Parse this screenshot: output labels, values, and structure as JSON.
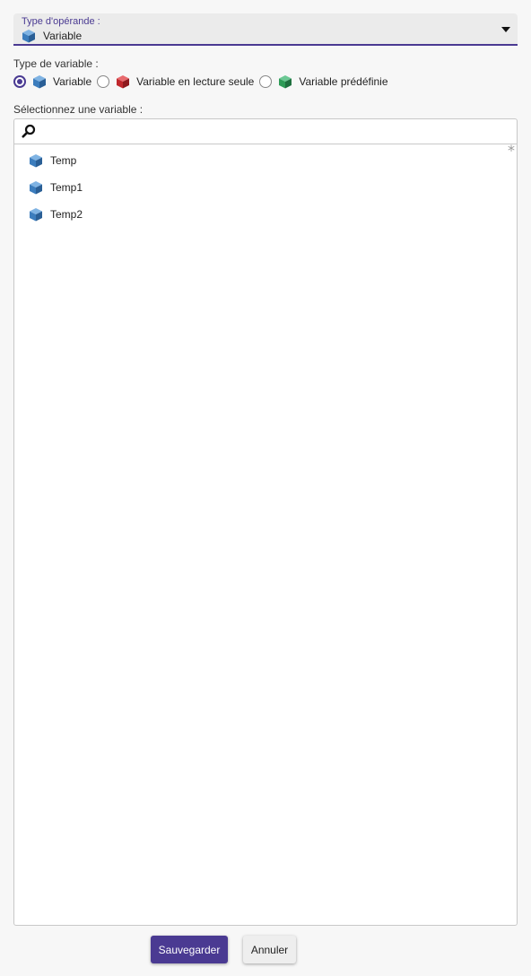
{
  "operand_select": {
    "label": "Type d'opérande :",
    "value": "Variable",
    "value_icon": "blue-cube-icon"
  },
  "variable_type": {
    "label": "Type de variable :",
    "options": [
      {
        "label": "Variable",
        "icon": "blue-cube-icon",
        "checked": true
      },
      {
        "label": "Variable en lecture seule",
        "icon": "red-cube-icon",
        "checked": false
      },
      {
        "label": "Variable prédéfinie",
        "icon": "green-cube-icon",
        "checked": false
      }
    ]
  },
  "variable_select": {
    "label": "Sélectionnez une variable :",
    "search_value": "",
    "items": [
      {
        "label": "Temp",
        "icon": "blue-cube-icon"
      },
      {
        "label": "Temp1",
        "icon": "blue-cube-icon"
      },
      {
        "label": "Temp2",
        "icon": "blue-cube-icon"
      }
    ],
    "required_marker": "*"
  },
  "buttons": {
    "save_label": "Sauvegarder",
    "cancel_label": "Annuler"
  },
  "colors": {
    "accent": "#4a3a92",
    "variable_cube": "#3c7dbd",
    "readonly_cube": "#c0282d",
    "predefined_cube": "#2e9b57"
  }
}
